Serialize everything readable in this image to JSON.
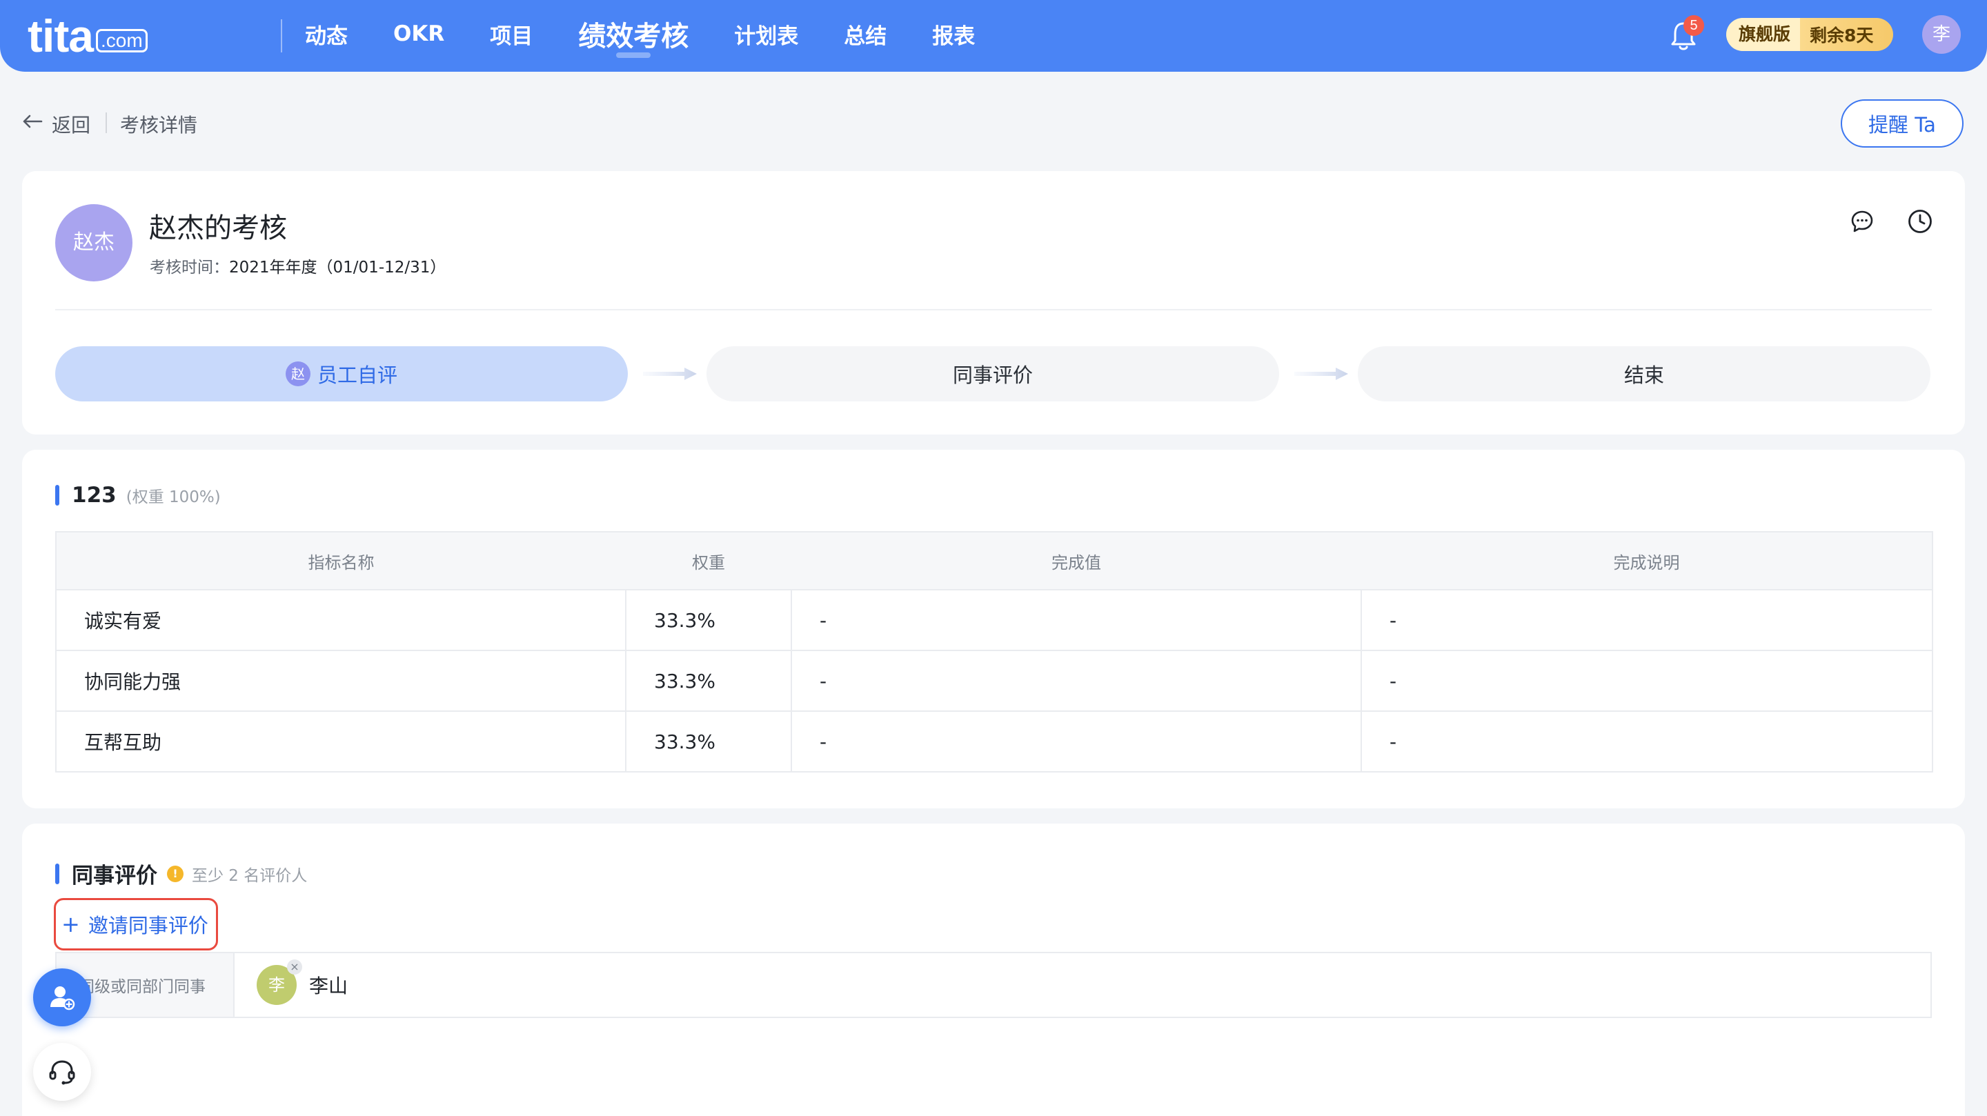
{
  "app": {
    "logo_main": "tita",
    "logo_suffix": ".com"
  },
  "nav": {
    "items": [
      {
        "label": "动态"
      },
      {
        "label": "OKR"
      },
      {
        "label": "项目"
      },
      {
        "label": "绩效考核"
      },
      {
        "label": "计划表"
      },
      {
        "label": "总结"
      },
      {
        "label": "报表"
      }
    ],
    "active": "绩效考核"
  },
  "topbar": {
    "notification_count": "5",
    "plan_label": "旗舰版",
    "plan_remaining": "剩余8天",
    "user_avatar_initial": "李",
    "brand_color": "#4a84f5"
  },
  "breadcrumb": {
    "back_label": "返回",
    "current": "考核详情"
  },
  "remind_button": "提醒 Ta",
  "review": {
    "avatar_text": "赵杰",
    "title": "赵杰的考核",
    "time_label": "考核时间：",
    "time_value": "2021年年度（01/01-12/31）"
  },
  "steps": [
    {
      "label": "员工自评",
      "avatar": "赵",
      "active": true
    },
    {
      "label": "同事评价",
      "active": false
    },
    {
      "label": "结束",
      "active": false
    }
  ],
  "kpi_section": {
    "name": "123",
    "weight": "(权重 100%)",
    "columns": [
      "指标名称",
      "权重",
      "完成值",
      "完成说明"
    ],
    "rows": [
      [
        "诚实有爱",
        "33.3%",
        "-",
        "-"
      ],
      [
        "协同能力强",
        "33.3%",
        "-",
        "-"
      ],
      [
        "互帮互助",
        "33.3%",
        "-",
        "-"
      ]
    ]
  },
  "peer_section": {
    "title": "同事评价",
    "hint_icon": "!",
    "hint": "至少 2 名评价人",
    "invite_label": "邀请同事评价",
    "group_label": "同级或同部门同事",
    "reviewers": [
      {
        "initial": "李",
        "name": "李山"
      }
    ]
  },
  "icons": {
    "back": "arrow-left-icon",
    "bell": "bell-icon",
    "chat": "chat-bubble-icon",
    "clock": "clock-icon",
    "user_add": "user-add-icon",
    "support": "headset-icon"
  }
}
